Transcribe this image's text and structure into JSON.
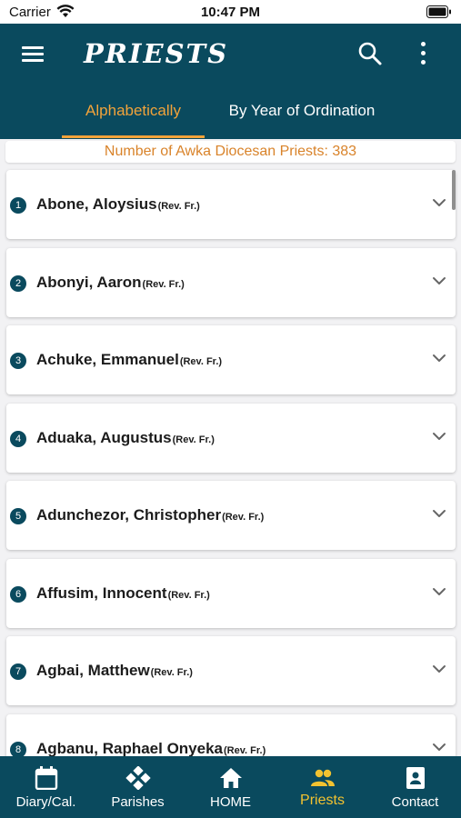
{
  "status_bar": {
    "carrier": "Carrier",
    "time": "10:47 PM"
  },
  "header": {
    "title": "PRIESTS",
    "tabs": [
      {
        "label": "Alphabetically",
        "active": true
      },
      {
        "label": "By Year of Ordination",
        "active": false
      }
    ]
  },
  "count_banner": "Number of Awka Diocesan Priests: 383",
  "priests": [
    {
      "number": "1",
      "name": "Abone, Aloysius",
      "title": "(Rev. Fr.)"
    },
    {
      "number": "2",
      "name": "Abonyi, Aaron",
      "title": "(Rev. Fr.)"
    },
    {
      "number": "3",
      "name": "Achuke, Emmanuel",
      "title": "(Rev. Fr.)"
    },
    {
      "number": "4",
      "name": "Aduaka, Augustus",
      "title": "(Rev. Fr.)"
    },
    {
      "number": "5",
      "name": "Adunchezor, Christopher",
      "title": "(Rev. Fr.)"
    },
    {
      "number": "6",
      "name": "Affusim, Innocent",
      "title": "(Rev. Fr.)"
    },
    {
      "number": "7",
      "name": "Agbai, Matthew",
      "title": "(Rev. Fr.)"
    },
    {
      "number": "8",
      "name": "Agbanu, Raphael Onyeka",
      "title": "(Rev. Fr.)"
    }
  ],
  "bottom_nav": [
    {
      "label": "Diary/Cal.",
      "icon": "calendar-icon",
      "active": false
    },
    {
      "label": "Parishes",
      "icon": "parishes-icon",
      "active": false
    },
    {
      "label": "HOME",
      "icon": "home-icon",
      "active": false
    },
    {
      "label": "Priests",
      "icon": "people-icon",
      "active": true
    },
    {
      "label": "Contact",
      "icon": "contact-icon",
      "active": false
    }
  ],
  "colors": {
    "primary": "#0a4a5e",
    "accent": "#f2a33a",
    "nav_active": "#f2c230",
    "count_text": "#d9832a"
  }
}
